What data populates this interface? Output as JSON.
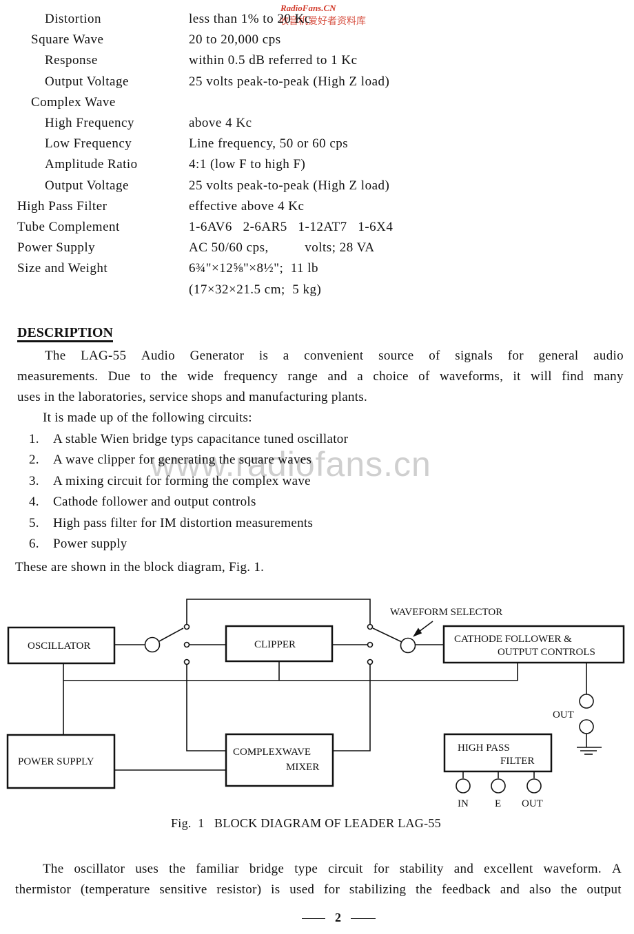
{
  "watermarks": {
    "site": "RadioFans.CN",
    "site_cn": "收音机爱好者资料库",
    "center": "www.radiofans.cn"
  },
  "specs": [
    {
      "label": "Distortion",
      "value": "less than 1% to 20 Kc",
      "indent": 2
    },
    {
      "label": "Square Wave",
      "value": "20 to 20,000 cps",
      "indent": 1
    },
    {
      "label": "Response",
      "value": "within 0.5 dB referred to 1 Kc",
      "indent": 2
    },
    {
      "label": "Output Voltage",
      "value": "25 volts peak-to-peak (High Z load)",
      "indent": 2
    },
    {
      "label": "Complex Wave",
      "value": "",
      "indent": 1
    },
    {
      "label": "High Frequency",
      "value": "above 4 Kc",
      "indent": 2
    },
    {
      "label": "Low Frequency",
      "value": "Line frequency, 50 or 60 cps",
      "indent": 2
    },
    {
      "label": "Amplitude Ratio",
      "value": "4:1 (low F to high F)",
      "indent": 2
    },
    {
      "label": "Output Voltage",
      "value": "25 volts peak-to-peak (High Z load)",
      "indent": 2
    },
    {
      "label": "High Pass Filter",
      "value": "effective above 4 Kc",
      "indent": 0
    },
    {
      "label": "Tube Complement",
      "value": "1-6AV6   2-6AR5   1-12AT7   1-6X4",
      "indent": 0
    },
    {
      "label": "Power Supply",
      "value": "AC 50/60 cps,          volts; 28 VA",
      "indent": 0
    },
    {
      "label": "Size and Weight",
      "value": "6¾\"×12⅝\"×8½\";  11 lb",
      "indent": 0
    },
    {
      "label": "",
      "value": "(17×32×21.5 cm;  5 kg)",
      "indent": 0
    }
  ],
  "description": {
    "heading": "DESCRIPTION",
    "intro_lines": [
      [
        "The",
        "LAG-55",
        "Audio",
        "Generator",
        "is",
        "a",
        "convenient",
        "source",
        "of",
        "signals",
        "for",
        "general",
        "audio"
      ],
      [
        "measurements.",
        "Due",
        "to",
        "the",
        "wide",
        "frequency",
        "range",
        "and",
        "a",
        "choice",
        "of",
        "waveforms,",
        "it",
        "will",
        "find",
        "many"
      ]
    ],
    "intro_last": "uses in the laboratories, service shops and manufacturing plants.",
    "list_intro": "It is made up of the following circuits:",
    "circuits": [
      {
        "num": "1.",
        "text": "A stable Wien bridge typs capacitance tuned oscillator"
      },
      {
        "num": "2.",
        "text": "A wave clipper for generating the square waves"
      },
      {
        "num": "3.",
        "text": "A mixing circuit for forming the complex wave"
      },
      {
        "num": "4.",
        "text": "Cathode follower and output controls"
      },
      {
        "num": "5.",
        "text": "High pass filter for IM distortion measurements"
      },
      {
        "num": "6.",
        "text": "Power supply"
      }
    ],
    "closing": "These are shown in the block diagram, Fig. 1."
  },
  "diagram": {
    "blocks": {
      "oscillator": "OSCILLATOR",
      "clipper": "CLIPPER",
      "cathode_line1": "CATHODE FOLLOWER &",
      "cathode_line2": "OUTPUT CONTROLS",
      "power_supply": "POWER SUPPLY",
      "mixer_line1": "COMPLEXWAVE",
      "mixer_line2": "MIXER",
      "hpf_line1": "HIGH PASS",
      "hpf_line2": "FILTER"
    },
    "labels": {
      "waveform_selector": "WAVEFORM SELECTOR",
      "out": "OUT",
      "hpf_in": "IN",
      "hpf_e": "E",
      "hpf_out": "OUT"
    },
    "caption": "Fig.  1   BLOCK DIAGRAM OF LEADER LAG-55"
  },
  "body_after": {
    "line1": [
      "The",
      "oscillator",
      "uses",
      "the",
      "familiar",
      "bridge",
      "type",
      "circuit",
      "for",
      "stability",
      "and",
      "excellent",
      "waveform.",
      "A"
    ],
    "line2": [
      "thermistor",
      "(temperature",
      "sensitive",
      "resistor)",
      "is",
      "used",
      "for",
      "stabilizing",
      "the",
      "feedback",
      "and",
      "also",
      "the",
      "output"
    ]
  },
  "page_number": "2"
}
